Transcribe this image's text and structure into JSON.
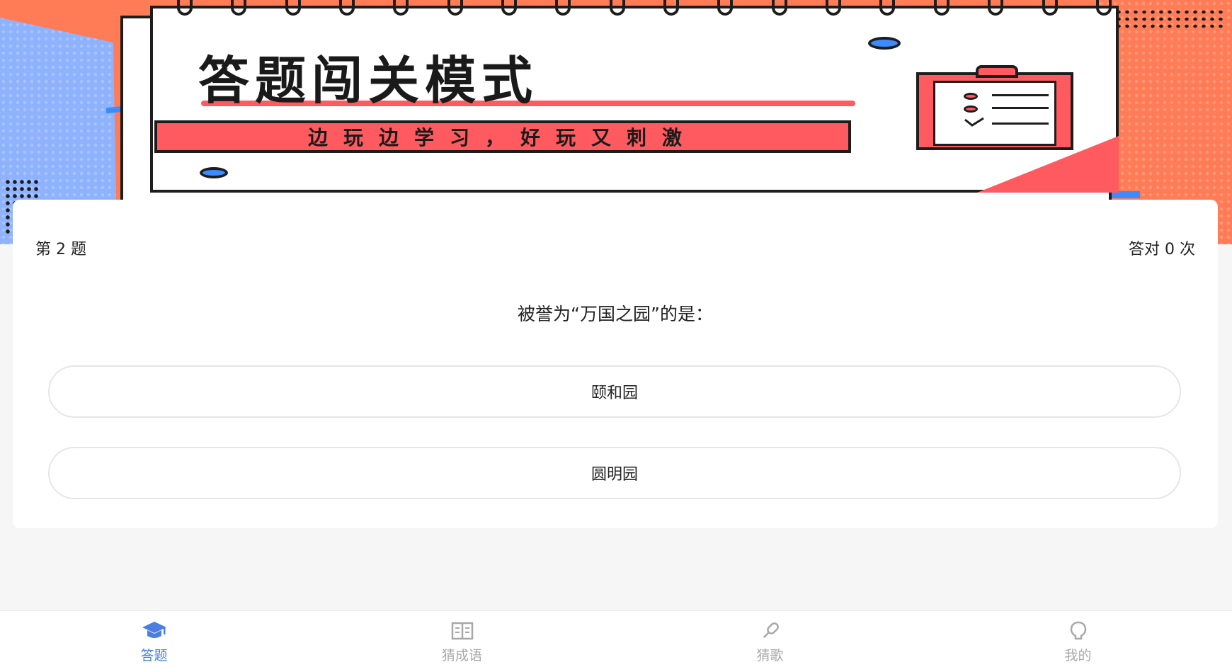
{
  "banner": {
    "title": "答题闯关模式",
    "subtitle": "边玩边学习，好玩又刺激"
  },
  "quiz": {
    "question_number": "第 2 题",
    "correct_count": "答对 0 次",
    "question": "被誉为“万国之园”的是：",
    "options": [
      {
        "label": "颐和园"
      },
      {
        "label": "圆明园"
      }
    ]
  },
  "tabbar": {
    "items": [
      {
        "label": "答题",
        "icon": "graduation-cap-icon",
        "active": true
      },
      {
        "label": "猜成语",
        "icon": "book-icon",
        "active": false
      },
      {
        "label": "猜歌",
        "icon": "microphone-icon",
        "active": false
      },
      {
        "label": "我的",
        "icon": "user-icon",
        "active": false
      }
    ]
  },
  "colors": {
    "accent": "#4a7fe0",
    "inactive": "#a8a8a8",
    "banner_orange": "#ff7c57",
    "banner_pink": "#ff5a5f",
    "banner_blue": "#3d8bff"
  }
}
